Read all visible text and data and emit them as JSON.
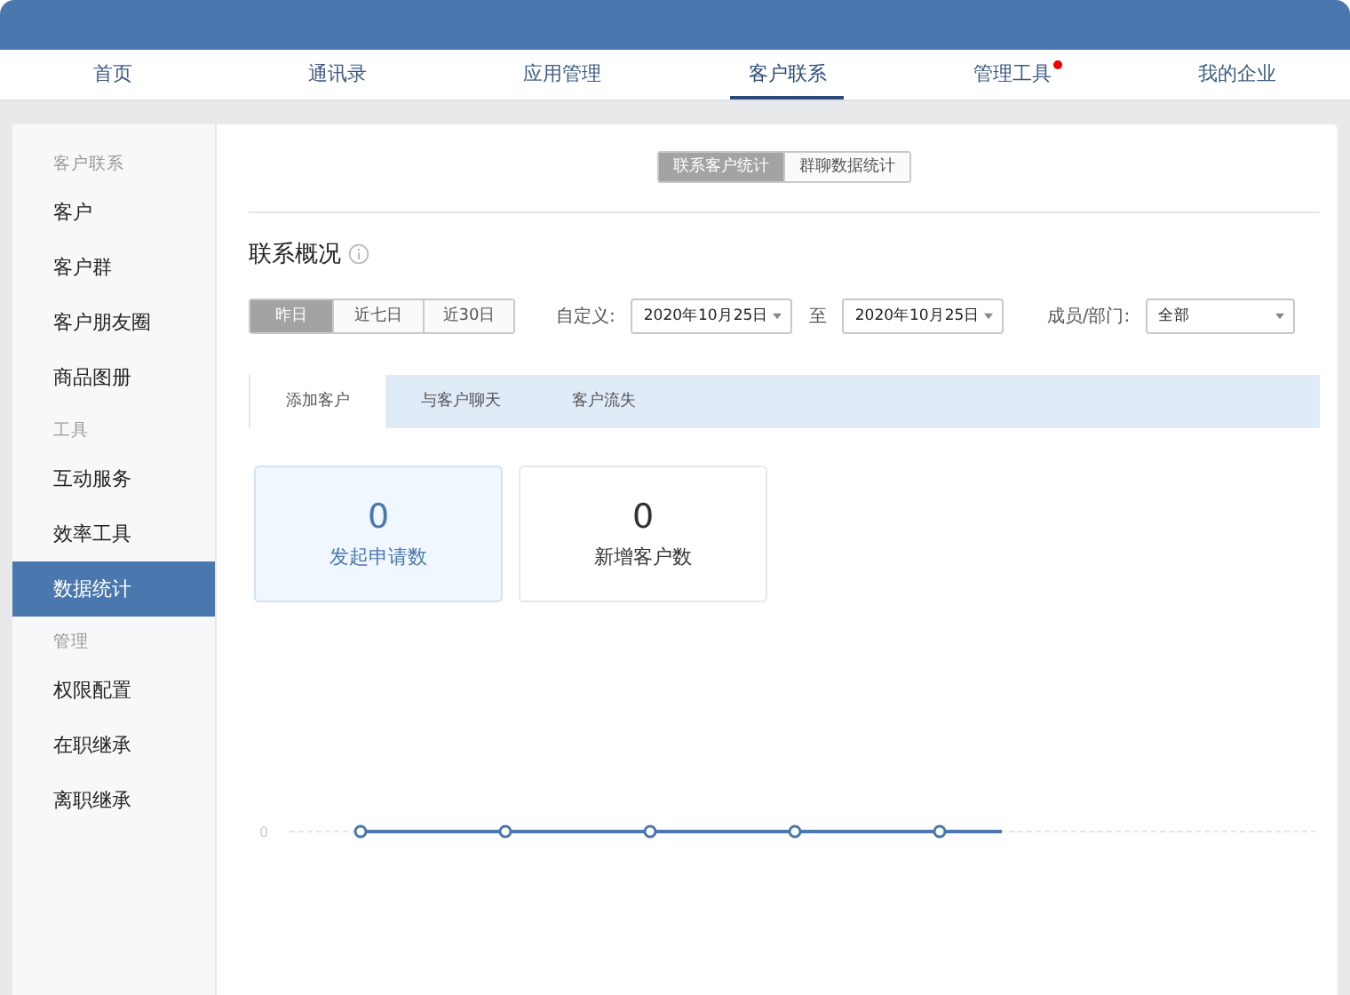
{
  "nav": [
    {
      "label": "首页",
      "selected": false,
      "badge": false
    },
    {
      "label": "通讯录",
      "selected": false,
      "badge": false
    },
    {
      "label": "应用管理",
      "selected": false,
      "badge": false
    },
    {
      "label": "客户联系",
      "selected": true,
      "badge": false
    },
    {
      "label": "管理工具",
      "selected": false,
      "badge": true
    },
    {
      "label": "我的企业",
      "selected": false,
      "badge": false
    }
  ],
  "sidebar": {
    "items": [
      {
        "kind": "heading",
        "label": "客户联系"
      },
      {
        "kind": "item",
        "label": "客户",
        "selected": false
      },
      {
        "kind": "item",
        "label": "客户群",
        "selected": false
      },
      {
        "kind": "item",
        "label": "客户朋友圈",
        "selected": false
      },
      {
        "kind": "item",
        "label": "商品图册",
        "selected": false
      },
      {
        "kind": "heading",
        "label": "工具"
      },
      {
        "kind": "item",
        "label": "互动服务",
        "selected": false
      },
      {
        "kind": "item",
        "label": "效率工具",
        "selected": false
      },
      {
        "kind": "item",
        "label": "数据统计",
        "selected": true
      },
      {
        "kind": "heading",
        "label": "管理"
      },
      {
        "kind": "item",
        "label": "权限配置",
        "selected": false
      },
      {
        "kind": "item",
        "label": "在职继承",
        "selected": false
      },
      {
        "kind": "item",
        "label": "离职继承",
        "selected": false
      }
    ]
  },
  "view_switch": [
    {
      "label": "联系客户统计",
      "selected": true
    },
    {
      "label": "群聊数据统计",
      "selected": false
    }
  ],
  "section_title": "联系概况",
  "ranges": [
    {
      "label": "昨日",
      "selected": true
    },
    {
      "label": "近七日",
      "selected": false
    },
    {
      "label": "近30日",
      "selected": false
    }
  ],
  "custom_label": "自定义:",
  "date_from": "2020年10月25日",
  "to_label": "至",
  "date_to": "2020年10月25日",
  "member_label": "成员/部门:",
  "member_value": "全部",
  "tabs": [
    {
      "label": "添加客户",
      "selected": true
    },
    {
      "label": "与客户聊天",
      "selected": false
    },
    {
      "label": "客户流失",
      "selected": false
    }
  ],
  "stats": [
    {
      "value": "0",
      "label": "发起申请数",
      "selected": true
    },
    {
      "value": "0",
      "label": "新增客户数",
      "selected": false
    }
  ],
  "chart": {
    "y_label": "0"
  }
}
